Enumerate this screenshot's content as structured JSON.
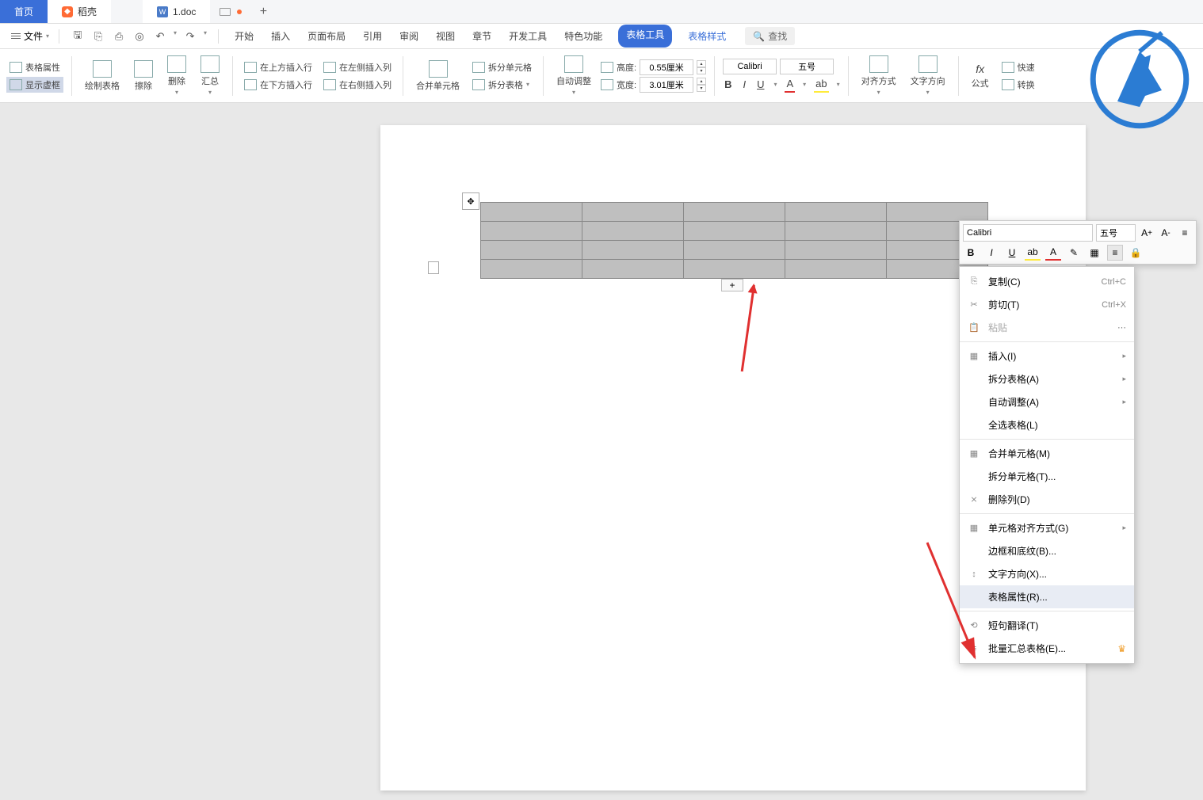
{
  "tabs": {
    "home": "首页",
    "docer": "稻壳",
    "file": "1.doc"
  },
  "menubar": {
    "file_label": "文件",
    "tabs": [
      "开始",
      "插入",
      "页面布局",
      "引用",
      "审阅",
      "视图",
      "章节",
      "开发工具",
      "特色功能",
      "表格工具",
      "表格样式"
    ],
    "search": "查找"
  },
  "ribbon": {
    "table_props": "表格属性",
    "show_grid": "显示虚框",
    "draw_table": "绘制表格",
    "eraser": "擦除",
    "delete": "删除",
    "summary": "汇总",
    "insert_above": "在上方插入行",
    "insert_below": "在下方插入行",
    "insert_left": "在左侧插入列",
    "insert_right": "在右侧插入列",
    "merge_cells": "合并单元格",
    "split_cells": "拆分单元格",
    "split_table": "拆分表格",
    "auto_adjust": "自动调整",
    "height_label": "高度:",
    "width_label": "宽度:",
    "height_value": "0.55厘米",
    "width_value": "3.01厘米",
    "font_name": "Calibri",
    "font_size": "五号",
    "align": "对齐方式",
    "text_dir": "文字方向",
    "formula": "公式",
    "quick": "快速",
    "convert": "转换"
  },
  "mini_toolbar": {
    "font_name": "Calibri",
    "font_size": "五号"
  },
  "context_menu": {
    "copy": "复制(C)",
    "copy_shortcut": "Ctrl+C",
    "cut": "剪切(T)",
    "cut_shortcut": "Ctrl+X",
    "paste": "粘贴",
    "insert": "插入(I)",
    "split_table": "拆分表格(A)",
    "auto_adjust": "自动调整(A)",
    "select_all": "全选表格(L)",
    "merge_cells": "合并单元格(M)",
    "split_cells": "拆分单元格(T)...",
    "delete_col": "删除列(D)",
    "cell_align": "单元格对齐方式(G)",
    "border_shading": "边框和底纹(B)...",
    "text_direction": "文字方向(X)...",
    "table_props": "表格属性(R)...",
    "phrase_translate": "短句翻译(T)",
    "batch_summary": "批量汇总表格(E)..."
  }
}
